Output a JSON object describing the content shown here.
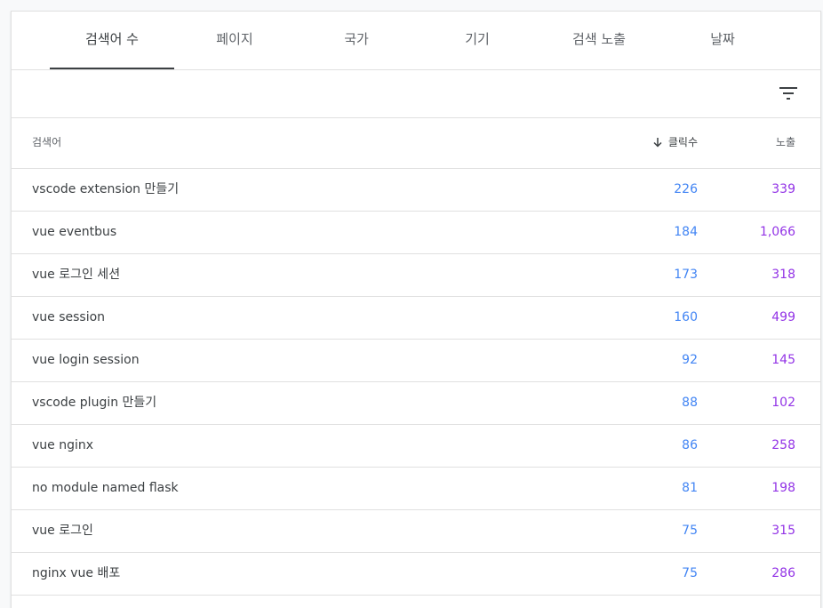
{
  "tabs": [
    {
      "label": "검색어 수",
      "active": true
    },
    {
      "label": "페이지",
      "active": false
    },
    {
      "label": "국가",
      "active": false
    },
    {
      "label": "기기",
      "active": false
    },
    {
      "label": "검색 노출",
      "active": false
    },
    {
      "label": "날짜",
      "active": false
    }
  ],
  "toolbar": {
    "filter_icon": "filter-icon"
  },
  "table": {
    "headers": {
      "query": "검색어",
      "sort_icon": "arrow-down-icon",
      "clicks": "클릭수",
      "impressions": "노출"
    },
    "rows": [
      {
        "query": "vscode extension 만들기",
        "clicks": "226",
        "impressions": "339"
      },
      {
        "query": "vue eventbus",
        "clicks": "184",
        "impressions": "1,066"
      },
      {
        "query": "vue 로그인 세션",
        "clicks": "173",
        "impressions": "318"
      },
      {
        "query": "vue session",
        "clicks": "160",
        "impressions": "499"
      },
      {
        "query": "vue login session",
        "clicks": "92",
        "impressions": "145"
      },
      {
        "query": "vscode plugin 만들기",
        "clicks": "88",
        "impressions": "102"
      },
      {
        "query": "vue nginx",
        "clicks": "86",
        "impressions": "258"
      },
      {
        "query": "no module named flask",
        "clicks": "81",
        "impressions": "198"
      },
      {
        "query": "vue 로그인",
        "clicks": "75",
        "impressions": "315"
      },
      {
        "query": "nginx vue 배포",
        "clicks": "75",
        "impressions": "286"
      }
    ]
  },
  "colors": {
    "clicks": "#4285f4",
    "impressions": "#9334e6",
    "active_tab": "#3c4043"
  }
}
